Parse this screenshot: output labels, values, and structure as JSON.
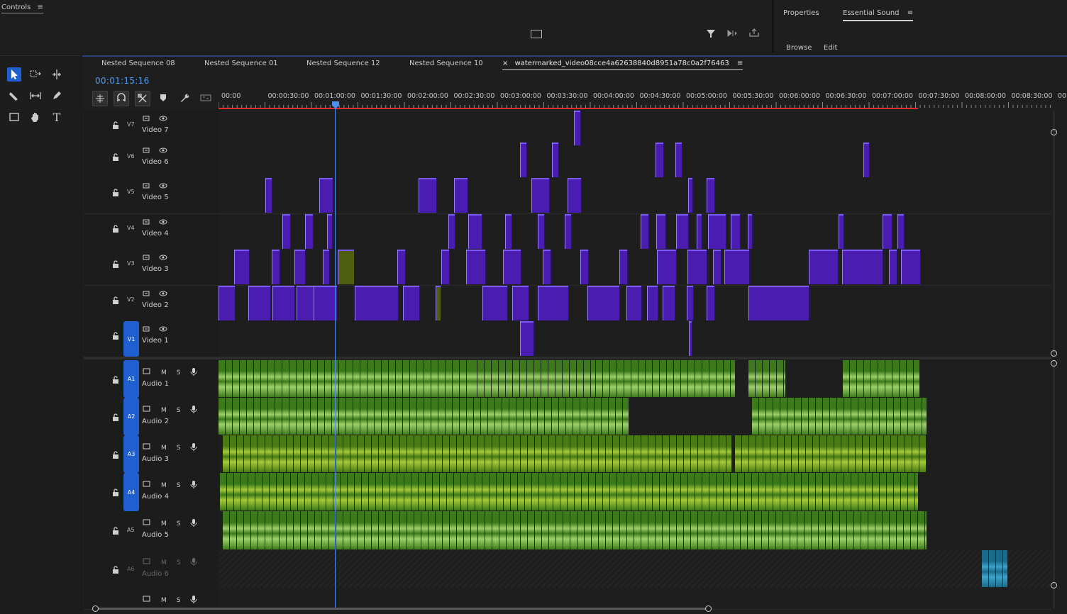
{
  "controls_panel": {
    "title": "Controls"
  },
  "right_panel": {
    "tabs": [
      "Properties",
      "Essential Sound"
    ],
    "sub_tabs": [
      "Browse",
      "Edit"
    ]
  },
  "sequence_tabs": [
    "Nested Sequence 08",
    "Nested Sequence 01",
    "Nested Sequence 12",
    "Nested Sequence 10",
    "watermarked_video08cce4a62638840d8951a78c0a2f76463"
  ],
  "close_glyph": "×",
  "menu_glyph": "≡",
  "timecode": "00:01:15:16",
  "ruler_labels": [
    "00:00",
    "00:00:30:00",
    "00:01:00:00",
    "00:01:30:00",
    "00:02:00:00",
    "00:02:30:00",
    "00:03:00:00",
    "00:03:30:00",
    "00:04:00:00",
    "00:04:30:00",
    "00:05:00:00",
    "00:05:30:00",
    "00:06:00:00",
    "00:06:30:00",
    "00:07:00:00",
    "00:07:30:00",
    "00:08:00:00",
    "00:08:30:00",
    "00:0"
  ],
  "video_tracks": [
    {
      "id": "V7",
      "name": "Video 7"
    },
    {
      "id": "V6",
      "name": "Video 6"
    },
    {
      "id": "V5",
      "name": "Video 5"
    },
    {
      "id": "V4",
      "name": "Video 4"
    },
    {
      "id": "V3",
      "name": "Video 3"
    },
    {
      "id": "V2",
      "name": "Video 2"
    },
    {
      "id": "V1",
      "name": "Video 1"
    }
  ],
  "audio_tracks": [
    {
      "id": "A1",
      "name": "Audio 1"
    },
    {
      "id": "A2",
      "name": "Audio 2"
    },
    {
      "id": "A3",
      "name": "Audio 3"
    },
    {
      "id": "A4",
      "name": "Audio 4"
    },
    {
      "id": "A5",
      "name": "Audio 5"
    },
    {
      "id": "A6",
      "name": "Audio 6"
    }
  ],
  "audio_buttons": {
    "mute": "M",
    "solo": "S"
  },
  "icons": [
    "selection-tool-icon",
    "track-select-icon",
    "ripple-edit-icon",
    "razor-icon",
    "slip-icon",
    "pen-icon",
    "rectangle-icon",
    "hand-icon",
    "type-icon",
    "filter-icon",
    "lock-icon",
    "eye-icon",
    "mic-icon"
  ],
  "colors": {
    "video_clip": "#4a1cb0",
    "audio_clip": "#3d7a1c",
    "playhead": "#4d8ff0",
    "work_area": "#e02c2c",
    "target_blue": "#1f5fd0"
  }
}
